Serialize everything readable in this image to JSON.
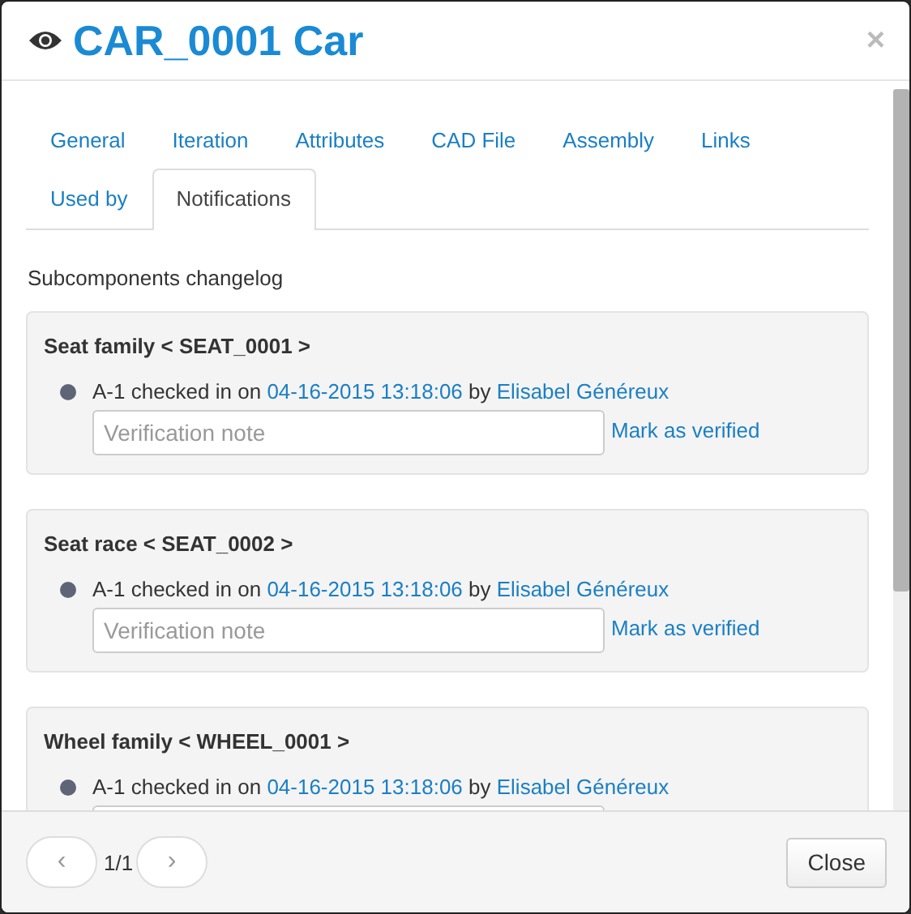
{
  "modal": {
    "title": "CAR_0001 Car",
    "close": "×"
  },
  "tabs": [
    {
      "label": "General",
      "selected": false
    },
    {
      "label": "Iteration",
      "selected": false
    },
    {
      "label": "Attributes",
      "selected": false
    },
    {
      "label": "CAD File",
      "selected": false
    },
    {
      "label": "Assembly",
      "selected": false
    },
    {
      "label": "Links",
      "selected": false
    },
    {
      "label": "Used by",
      "selected": false
    },
    {
      "label": "Notifications",
      "selected": true
    }
  ],
  "section_title": "Subcomponents changelog",
  "changes": [
    {
      "title": "Seat family < SEAT_0001 >",
      "version": "A-1",
      "text_checked": "checked in on",
      "date": "04-16-2015 13:18:06",
      "text_by": "by",
      "author": "Elisabel Généreux",
      "placeholder": "Verification note",
      "action": "Mark as verified"
    },
    {
      "title": "Seat race < SEAT_0002 >",
      "version": "A-1",
      "text_checked": "checked in on",
      "date": "04-16-2015 13:18:06",
      "text_by": "by",
      "author": "Elisabel Généreux",
      "placeholder": "Verification note",
      "action": "Mark as verified"
    },
    {
      "title": "Wheel family < WHEEL_0001 >",
      "version": "A-1",
      "text_checked": "checked in on",
      "date": "04-16-2015 13:18:06",
      "text_by": "by",
      "author": "Elisabel Généreux"
    }
  ],
  "pagination": {
    "prev": "‹",
    "page": "1/1",
    "next": "›"
  },
  "buttons": [
    "Close"
  ]
}
